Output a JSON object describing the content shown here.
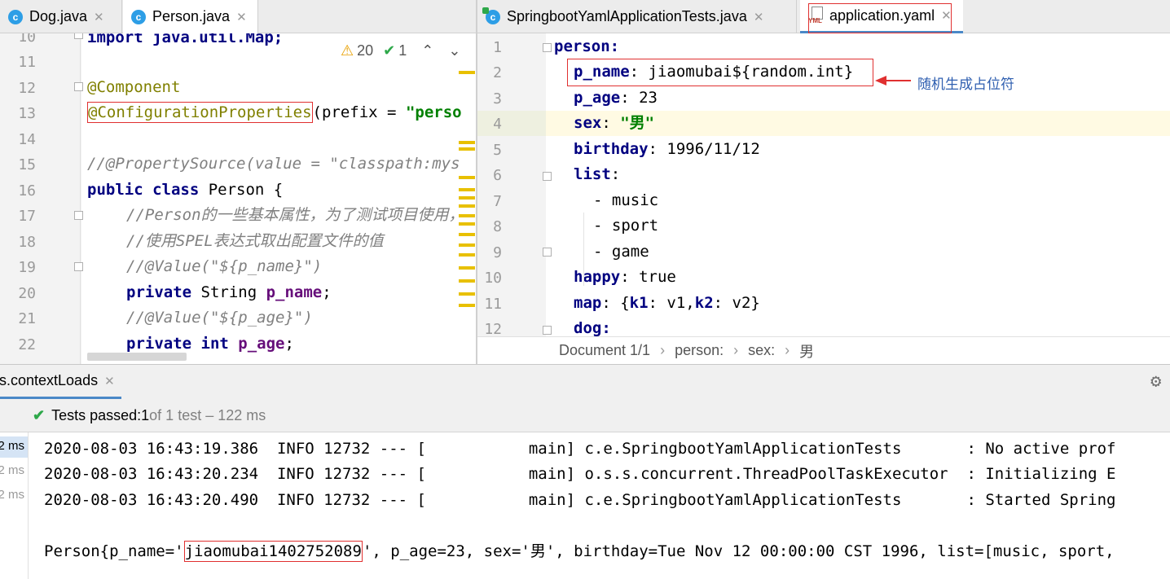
{
  "left_tabs": [
    {
      "label": "Dog.java",
      "icon": "java-class-icon"
    },
    {
      "label": "Person.java",
      "icon": "java-class-icon"
    }
  ],
  "right_tabs": [
    {
      "label": "SpringbootYamlApplicationTests.java",
      "icon": "java-test-class-icon"
    },
    {
      "label": "application.yaml",
      "icon": "yaml-file-icon"
    }
  ],
  "java_editor": {
    "line_numbers": [
      "10",
      "11",
      "12",
      "13",
      "14",
      "15",
      "16",
      "17",
      "18",
      "19",
      "20",
      "21",
      "22"
    ],
    "lines": {
      "l10": "import java.util.Map;",
      "l12": "@Component",
      "l13_ann": "@ConfigurationProperties",
      "l13_rest": "(prefix = ",
      "l13_str": "\"perso",
      "l15": "//@PropertySource(value = \"classpath:mys",
      "l16_kw": "public class",
      "l16_rest": " Person {",
      "l17": "//Person的一些基本属性，为了测试项目使用，",
      "l18": "//使用SPEL表达式取出配置文件的值",
      "l19": "//@Value(\"${p_name}\")",
      "l20_kw": "private",
      "l20_type": " String ",
      "l20_field": "p_name",
      "l21": "//@Value(\"${p_age}\")",
      "l22_kw": "private int",
      "l22_field": "p_age"
    },
    "inspections": {
      "warnings": "20",
      "ok": "1"
    }
  },
  "yaml_editor": {
    "line_numbers": [
      "1",
      "2",
      "3",
      "4",
      "5",
      "6",
      "7",
      "8",
      "9",
      "10",
      "11",
      "12"
    ],
    "lines": {
      "l1": "person:",
      "l2_key": "p_name",
      "l2_val": ": jiaomubai${random.int}",
      "l3_key": "p_age",
      "l3_val": ": 23",
      "l4_key": "sex",
      "l4_sep": ": ",
      "l4_val": "\"男\"",
      "l5_key": "birthday",
      "l5_val": ": 1996/11/12",
      "l6_key": "list",
      "l6_val": ":",
      "l7": "- music",
      "l8": "- sport",
      "l9": "- game",
      "l10_key": "happy",
      "l10_val": ": true",
      "l11_key": "map",
      "l11_a": ": {",
      "l11_k1": "k1",
      "l11_b": ": v1,",
      "l11_k2": "k2",
      "l11_c": ": v2}",
      "l12": "dog:"
    },
    "annotation": "随机生成占位符",
    "breadcrumb": [
      "Document 1/1",
      "person:",
      "sex:",
      "男"
    ]
  },
  "run_panel": {
    "tab_label": "ts.contextLoads",
    "status_prefix": "Tests passed: ",
    "status_count": "1",
    "status_suffix": " of 1 test – 122 ms",
    "durations": [
      "2 ms",
      "2 ms",
      "2 ms"
    ],
    "log_lines": [
      "2020-08-03 16:43:19.386  INFO 12732 --- [           main] c.e.SpringbootYamlApplicationTests       : No active prof",
      "2020-08-03 16:43:20.234  INFO 12732 --- [           main] o.s.s.concurrent.ThreadPoolTaskExecutor  : Initializing E",
      "2020-08-03 16:43:20.490  INFO 12732 --- [           main] c.e.SpringbootYamlApplicationTests       : Started Spring"
    ],
    "output_prefix": "Person{p_name='",
    "output_value": "jiaomubai1402752089",
    "output_suffix": "', p_age=23, sex='男', birthday=Tue Nov 12 00:00:00 CST 1996, list=[music, sport,"
  },
  "colors": {
    "accent": "#2d9ee6",
    "highlight_box": "#e03030",
    "warning": "#e8a000",
    "pass": "#2ea84a"
  }
}
